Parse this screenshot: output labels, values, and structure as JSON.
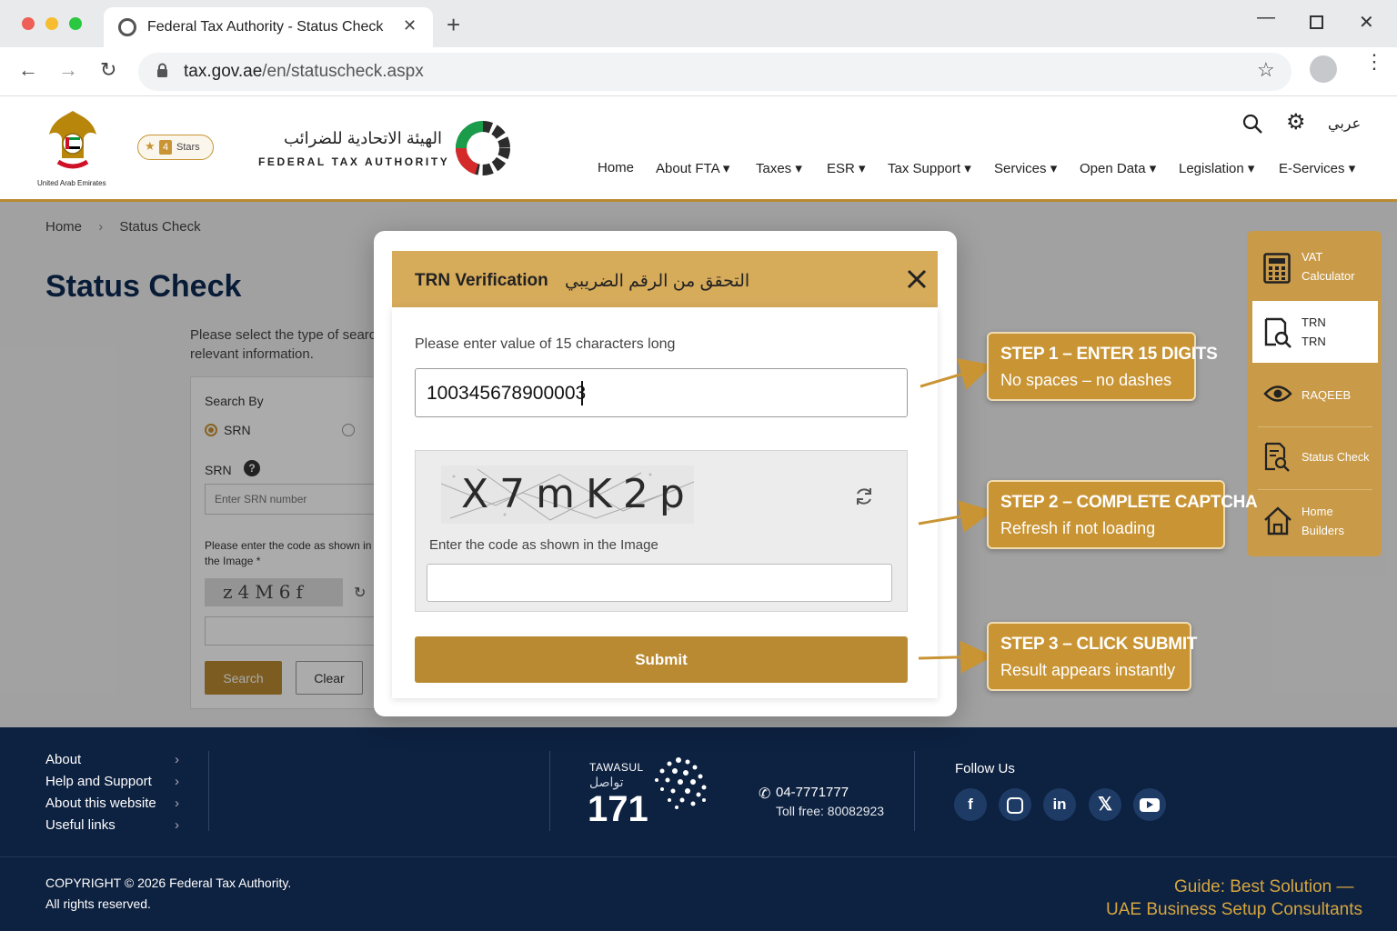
{
  "browser": {
    "tab_title": "Federal Tax Authority - Status Check",
    "url_domain": "tax.gov.ae",
    "url_path": "/en/statuscheck.aspx"
  },
  "header": {
    "emblem_caption": "United Arab Emirates",
    "stars_count": "4",
    "stars_label": "Stars",
    "logo_arabic": "الهيئة الاتحادية للضرائب",
    "logo_english": "FEDERAL TAX AUTHORITY",
    "lang_toggle": "عربي",
    "nav": [
      "Home",
      "About FTA",
      "Taxes",
      "ESR",
      "Tax Support",
      "Services",
      "Open Data",
      "Legislation",
      "E-Services"
    ]
  },
  "page": {
    "breadcrumb": [
      "Home",
      "Status Check"
    ],
    "title": "Status Check",
    "intro_line1": "Please select the type of search",
    "intro_line2": "relevant information.",
    "search_by_label": "Search By",
    "radio_srn": "SRN",
    "srn_label": "SRN",
    "srn_placeholder": "Enter SRN number",
    "captcha_prompt_line1": "Please enter the code as shown in",
    "captcha_prompt_line2": "the Image *",
    "captcha_text": "z4M6f",
    "search_button": "Search",
    "clear_button": "Clear"
  },
  "modal": {
    "title_en": "TRN Verification",
    "title_ar": "التحقق من الرقم الضريبي",
    "instruction": "Please enter value of 15 characters long",
    "trn_value": "100345678900003",
    "captcha_text": "X7mK2p",
    "captcha_prompt": "Enter the code as shown in the Image",
    "submit_label": "Submit"
  },
  "callouts": [
    {
      "title": "STEP 1 – ENTER 15 DIGITS",
      "subtitle": "No spaces – no dashes"
    },
    {
      "title": "STEP 2 – COMPLETE CAPTCHA",
      "subtitle": "Refresh if not loading"
    },
    {
      "title": "STEP 3 – CLICK SUBMIT",
      "subtitle": "Result appears instantly"
    }
  ],
  "side_panel": {
    "vat_line1": "VAT",
    "vat_line2": "Calculator",
    "trn_line1": "TRN",
    "trn_line2": "TRN",
    "raqeeb": "RAQEEB",
    "status_check": "Status Check",
    "home_line1": "Home",
    "home_line2": "Builders"
  },
  "footer": {
    "links": [
      "About",
      "Help and Support",
      "About this website",
      "Useful links"
    ],
    "tawasul_en": "TAWASUL",
    "tawasul_ar": "تواصل",
    "tawasul_number": "171",
    "phone": "04-7771777",
    "toll_free": "Toll free: 80082923",
    "follow_us": "Follow Us",
    "copyright_line1": "COPYRIGHT © 2026 Federal Tax Authority.",
    "copyright_line2": "All rights reserved.",
    "guide_line1": "Guide: Best Solution —",
    "guide_line2": "UAE Business Setup Consultants"
  },
  "colors": {
    "gold": "#c99433",
    "navy": "#0d2140",
    "modal_header": "#d6ab5a"
  }
}
